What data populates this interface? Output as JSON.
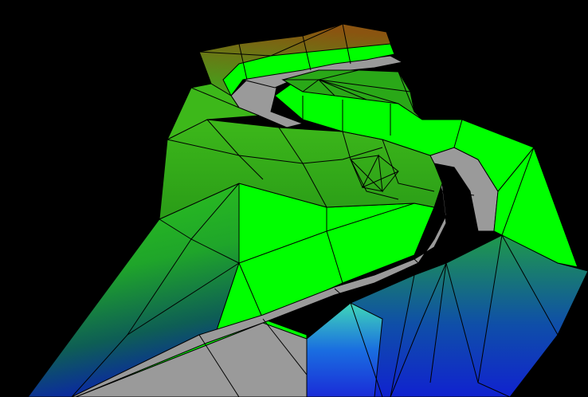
{
  "scene": {
    "background": "#000000",
    "wireframe": "#000000",
    "colors": {
      "terrain_green": "#2fbf10",
      "terrain_bright": "#00ff00",
      "terrain_dark": "#1f7a12",
      "road": "#9a9a9a",
      "ridge_brown": "#7a5a1a",
      "valley_blue": "#1233c8",
      "valley_cyan": "#33ccb0"
    },
    "description_icons": []
  }
}
